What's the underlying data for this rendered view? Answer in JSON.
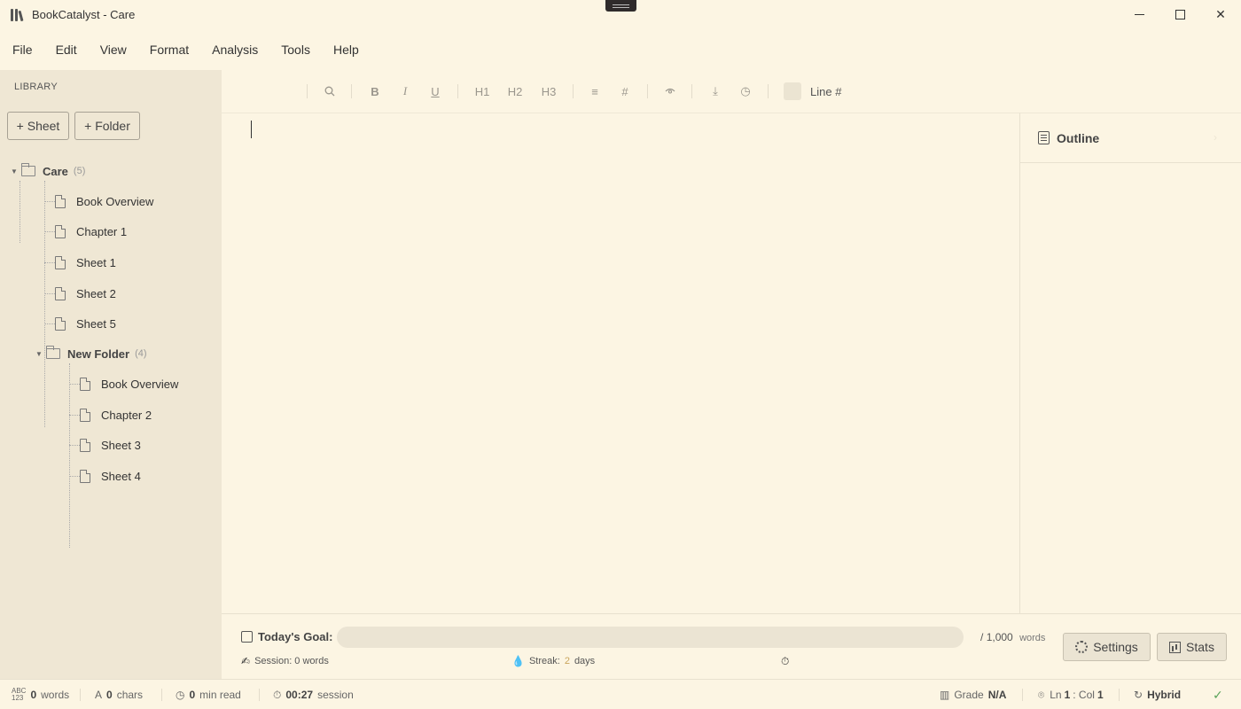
{
  "window": {
    "title": "BookCatalyst - Care",
    "controls": [
      "minimize",
      "maximize",
      "close"
    ]
  },
  "menu": [
    "File",
    "Edit",
    "View",
    "Format",
    "Analysis",
    "Tools",
    "Help"
  ],
  "sidebar": {
    "label": "LIBRARY",
    "add_sheet": "+ Sheet",
    "add_folder": "+ Folder",
    "tree": {
      "root": {
        "name": "Care",
        "count": "(5)"
      },
      "root_items": [
        "Book Overview",
        "Chapter 1",
        "Sheet 1",
        "Sheet 2",
        "Sheet 5"
      ],
      "subfolder": {
        "name": "New Folder",
        "count": "(4)"
      },
      "sub_items": [
        "Book Overview",
        "Chapter 2",
        "Sheet 3",
        "Sheet 4"
      ]
    }
  },
  "toolbar": {
    "h1": "H1",
    "h2": "H2",
    "h3": "H3",
    "line_numbers": "Line #",
    "icons": [
      "search-icon",
      "bold-icon",
      "italic-icon",
      "underline-icon",
      "align-icon",
      "hash-icon",
      "eye-icon",
      "download-icon",
      "history-icon"
    ]
  },
  "outline": {
    "title": "Outline"
  },
  "goal": {
    "label": "Today's Goal:",
    "progress": 0,
    "target_prefix": "/",
    "target": "1,000",
    "target_unit": "words",
    "settings": "Settings",
    "stats": "Stats",
    "session": "Session: 0 words",
    "streak_prefix": "Streak:",
    "streak_value": "2",
    "streak_suffix": "days"
  },
  "status": {
    "words_value": "0",
    "words_label": "words",
    "chars_value": "0",
    "chars_label": "chars",
    "read_value": "0",
    "read_label": "min read",
    "session_value": "00:27",
    "session_label": "session",
    "grade_label": "Grade",
    "grade_value": "N/A",
    "ln_label": "Ln",
    "ln_value": "1",
    "col_label": ": Col",
    "col_value": "1",
    "mode": "Hybrid"
  },
  "colors": {
    "background": "#fcf5e3",
    "sidebar": "#efe7d4",
    "accent": "#c9a45a",
    "ok": "#5aa35a"
  }
}
